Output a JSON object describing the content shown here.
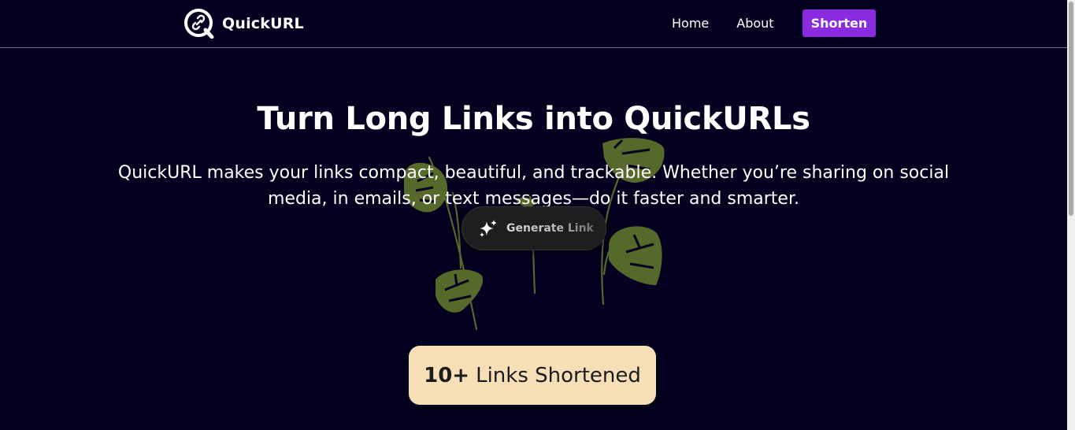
{
  "nav": {
    "brand": "QuickURL",
    "links": [
      {
        "label": "Home"
      },
      {
        "label": "About"
      }
    ],
    "cta_label": "Shorten"
  },
  "hero": {
    "title": "Turn Long Links into QuickURLs",
    "subtitle": "QuickURL makes your links compact, beautiful, and trackable. Whether you’re sharing on social media, in emails, or text messages—do it faster and smarter.",
    "button_label": "Generate Link",
    "button_icon": "sparkles-icon"
  },
  "stats": {
    "count": "10+",
    "label": "Links Shortened"
  },
  "colors": {
    "background": "#04001f",
    "accent": "#8a2be2",
    "card": "#f6dfb7",
    "leaf": "#55692b"
  }
}
